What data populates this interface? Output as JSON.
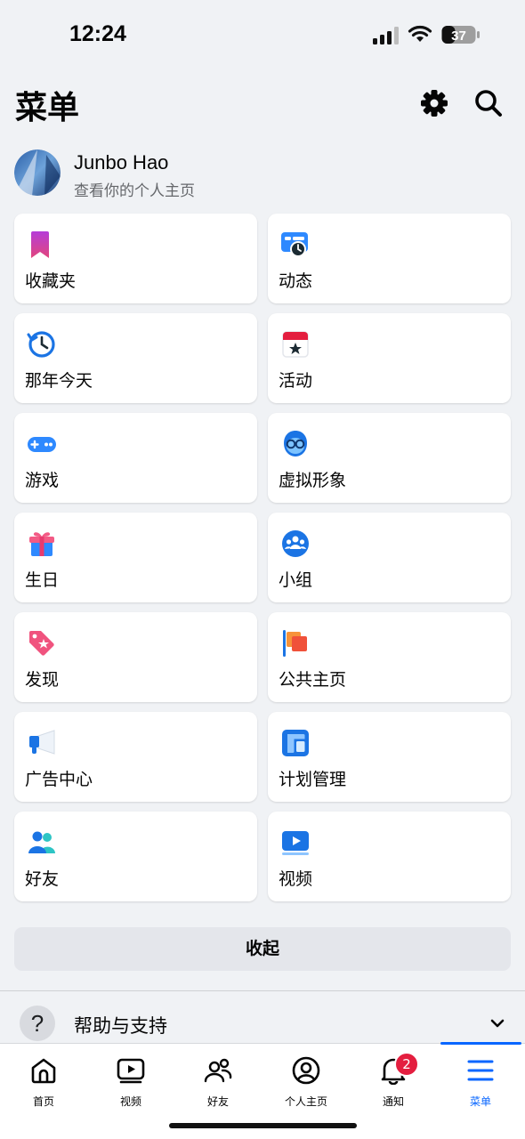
{
  "status": {
    "time": "12:24",
    "battery": "37"
  },
  "header": {
    "title": "菜单",
    "settings_icon": "gear-icon",
    "search_icon": "search-icon"
  },
  "profile": {
    "name": "Junbo Hao",
    "subtitle": "查看你的个人主页"
  },
  "shortcuts": [
    {
      "label": "收藏夹",
      "icon": "bookmark-icon"
    },
    {
      "label": "动态",
      "icon": "feeds-clock-icon"
    },
    {
      "label": "那年今天",
      "icon": "memories-clock-icon"
    },
    {
      "label": "活动",
      "icon": "calendar-star-icon"
    },
    {
      "label": "游戏",
      "icon": "gamepad-icon"
    },
    {
      "label": "虚拟形象",
      "icon": "avatar-face-icon"
    },
    {
      "label": "生日",
      "icon": "gift-icon"
    },
    {
      "label": "小组",
      "icon": "groups-icon"
    },
    {
      "label": "发现",
      "icon": "tag-star-icon"
    },
    {
      "label": "公共主页",
      "icon": "flag-icon"
    },
    {
      "label": "广告中心",
      "icon": "megaphone-icon"
    },
    {
      "label": "计划管理",
      "icon": "planner-icon"
    },
    {
      "label": "好友",
      "icon": "friends-icon"
    },
    {
      "label": "视频",
      "icon": "video-icon"
    }
  ],
  "collapse_label": "收起",
  "help": {
    "label": "帮助与支持",
    "icon": "question-icon"
  },
  "tabs": [
    {
      "label": "首页",
      "icon": "home-icon"
    },
    {
      "label": "视频",
      "icon": "video-play-icon"
    },
    {
      "label": "好友",
      "icon": "friends-outline-icon"
    },
    {
      "label": "个人主页",
      "icon": "profile-circle-icon"
    },
    {
      "label": "通知",
      "icon": "bell-icon",
      "badge": "2"
    },
    {
      "label": "菜单",
      "icon": "hamburger-menu-icon",
      "active": true
    }
  ],
  "colors": {
    "accent": "#0866FF",
    "background": "#F0F2F5",
    "badge": "#E41E3F"
  }
}
